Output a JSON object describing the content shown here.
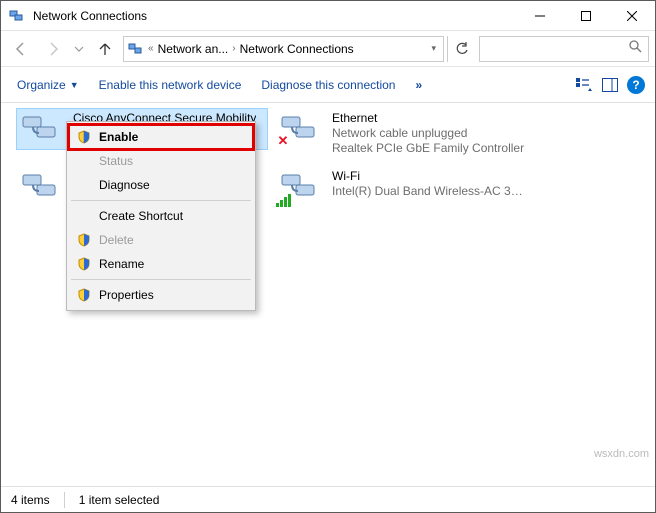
{
  "window": {
    "title": "Network Connections"
  },
  "breadcrumb": {
    "part1": "Network an...",
    "part2": "Network Connections"
  },
  "commands": {
    "organize": "Organize",
    "enable": "Enable this network device",
    "diagnose": "Diagnose this connection"
  },
  "adapters": {
    "cisco": {
      "name": "Cisco AnyConnect Secure Mobility"
    },
    "ethernet": {
      "name": "Ethernet",
      "status": "Network cable unplugged",
      "device": "Realtek PCIe GbE Family Controller"
    },
    "wifi": {
      "name": "Wi-Fi",
      "status": "",
      "device": "Intel(R) Dual Band Wireless-AC 31..."
    }
  },
  "contextMenu": {
    "enable": "Enable",
    "status": "Status",
    "diagnose": "Diagnose",
    "createShortcut": "Create Shortcut",
    "delete": "Delete",
    "rename": "Rename",
    "properties": "Properties"
  },
  "statusbar": {
    "count": "4 items",
    "selection": "1 item selected"
  },
  "watermark": "wsxdn.com"
}
